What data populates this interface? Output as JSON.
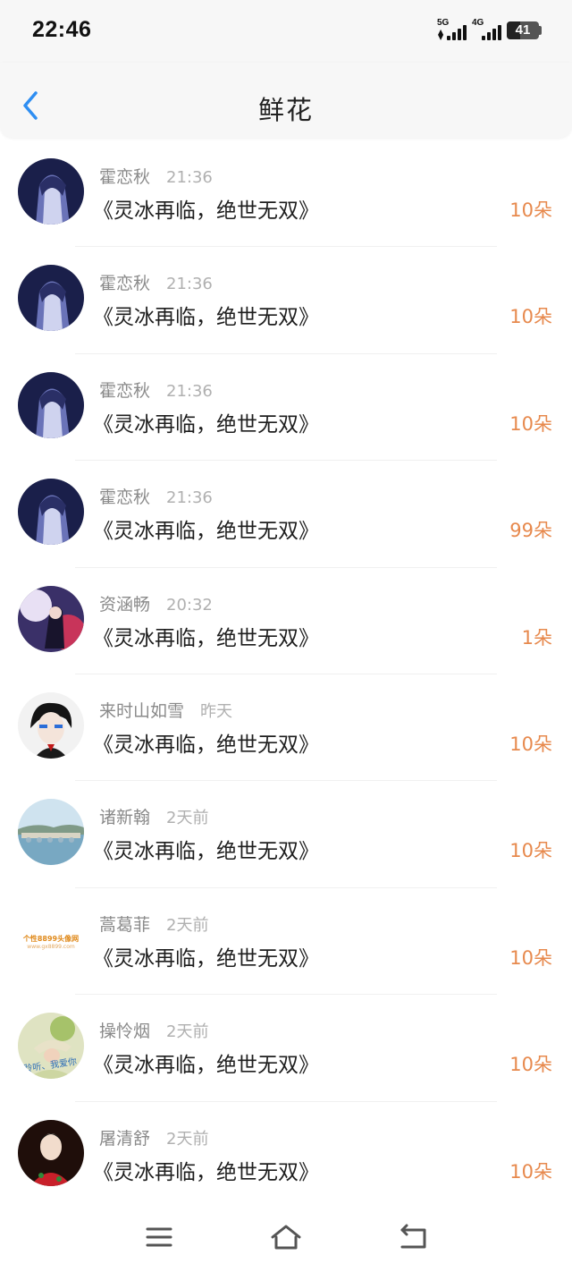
{
  "status_bar": {
    "time": "22:46",
    "network_1": "5G",
    "network_2": "4G",
    "battery": "41",
    "battery_level_percent": 41
  },
  "header": {
    "title": "鲜花",
    "back_icon": "chevron-left-icon"
  },
  "accent_colors": {
    "back": "#2e8ef2",
    "count": "#e7894d"
  },
  "items": [
    {
      "name": "霍恋秋",
      "time": "21:36",
      "message": "《灵冰再临，绝世无双》",
      "count": "10朵"
    },
    {
      "name": "霍恋秋",
      "time": "21:36",
      "message": "《灵冰再临，绝世无双》",
      "count": "10朵"
    },
    {
      "name": "霍恋秋",
      "time": "21:36",
      "message": "《灵冰再临，绝世无双》",
      "count": "10朵"
    },
    {
      "name": "霍恋秋",
      "time": "21:36",
      "message": "《灵冰再临，绝世无双》",
      "count": "99朵"
    },
    {
      "name": "资涵畅",
      "time": "20:32",
      "message": "《灵冰再临，绝世无双》",
      "count": "1朵"
    },
    {
      "name": "来时山如雪",
      "time": "昨天",
      "message": "《灵冰再临，绝世无双》",
      "count": "10朵"
    },
    {
      "name": "诸新翰",
      "time": "2天前",
      "message": "《灵冰再临，绝世无双》",
      "count": "10朵"
    },
    {
      "name": "蒿葛菲",
      "time": "2天前",
      "message": "《灵冰再临，绝世无双》",
      "count": "10朵",
      "avatar_text": "个性8899头像网",
      "avatar_subtext": "www.gx8899.com"
    },
    {
      "name": "操怜烟",
      "time": "2天前",
      "message": "《灵冰再临，绝世无双》",
      "count": "10朵",
      "avatar_text": "聆听、我爱你"
    },
    {
      "name": "屠清舒",
      "time": "2天前",
      "message": "《灵冰再临，绝世无双》",
      "count": "10朵"
    }
  ],
  "bottom_nav": {
    "menu_icon": "menu-icon",
    "home_icon": "home-icon",
    "back_icon": "back-icon"
  }
}
